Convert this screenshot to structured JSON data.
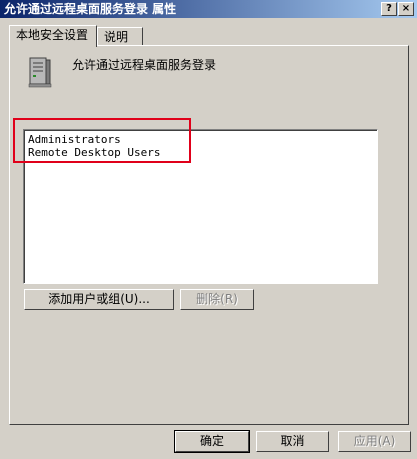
{
  "window": {
    "title": "允许通过远程桌面服务登录 属性",
    "help_button": "?",
    "close_button": "×"
  },
  "tabs": [
    {
      "label": "本地安全设置",
      "active": true
    },
    {
      "label": "说明",
      "active": false
    }
  ],
  "policy": {
    "icon": "server-icon",
    "title": "允许通过远程桌面服务登录"
  },
  "members": [
    "Administrators",
    "Remote Desktop Users"
  ],
  "buttons": {
    "add": "添加用户或组(U)...",
    "remove": "删除(R)",
    "ok": "确定",
    "cancel": "取消",
    "apply": "应用(A)"
  },
  "colors": {
    "titlebar_start": "#0a246a",
    "titlebar_end": "#a6caf0",
    "highlight": "#e0001a"
  }
}
